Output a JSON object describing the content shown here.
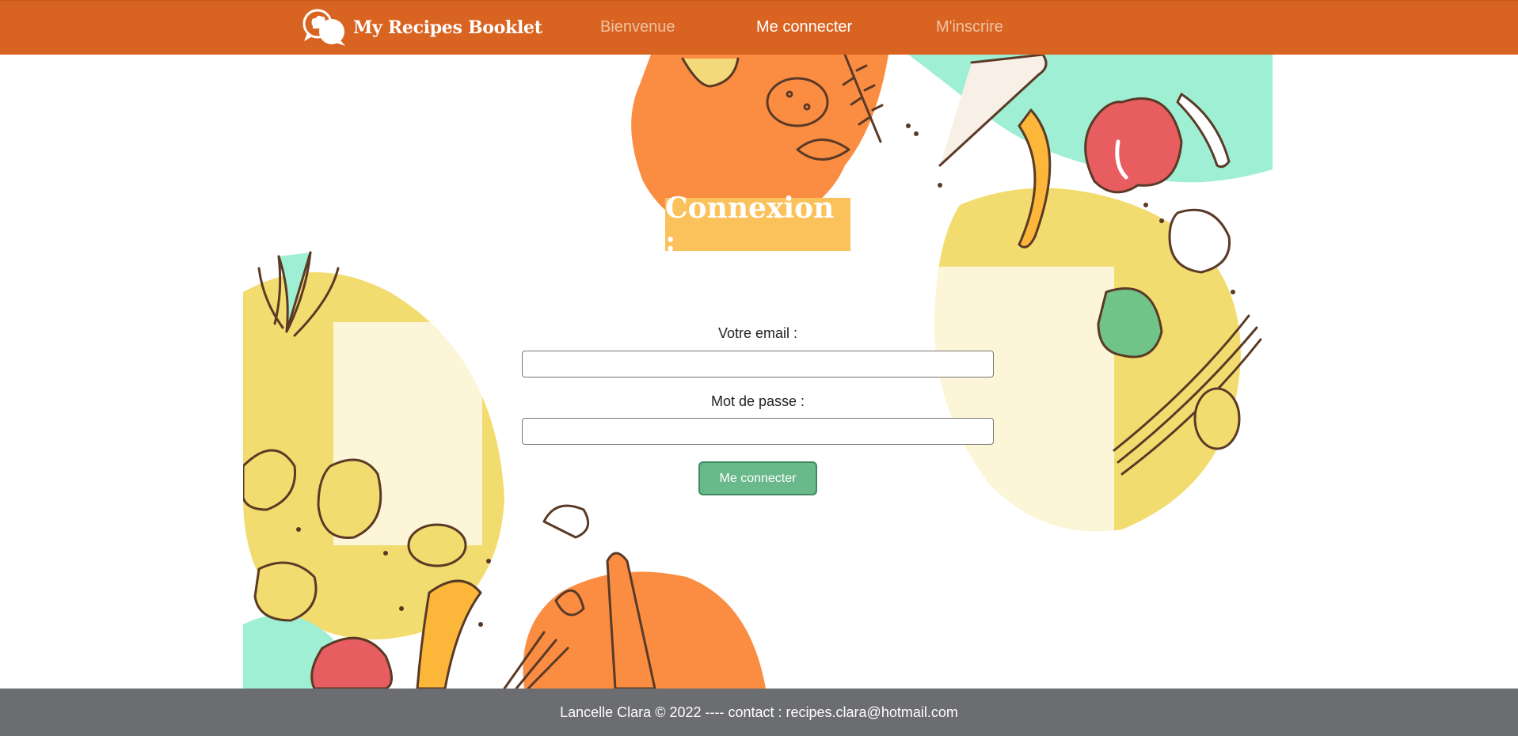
{
  "brand": {
    "name": "My Recipes Booklet",
    "logo_icon": "chef-speech-bubble-icon"
  },
  "nav": [
    {
      "label": "Bienvenue",
      "active": false
    },
    {
      "label": "Me connecter",
      "active": true
    },
    {
      "label": "M'inscrire",
      "active": false
    }
  ],
  "form": {
    "title": "Connexion :",
    "email_label": "Votre email :",
    "email_value": "",
    "password_label": "Mot de passe :",
    "password_value": "",
    "submit_label": "Me connecter"
  },
  "footer": {
    "text": "Lancelle Clara © 2022 ---- contact : recipes.clara@hotmail.com"
  },
  "colors": {
    "nav_bg": "#d96421",
    "title_bg": "#fbc25b",
    "button_bg": "#6ab98b",
    "footer_bg": "#6c6d70",
    "blob_orange": "#fb8d43",
    "blob_yellow": "#f3dc6f",
    "blob_mint": "#9eefd3"
  }
}
